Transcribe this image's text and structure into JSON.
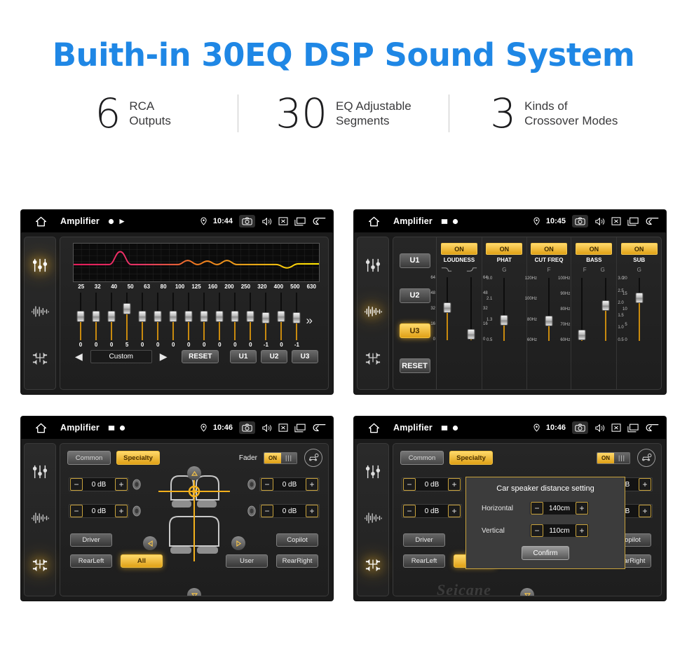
{
  "hero": {
    "title": "Buith-in 30EQ DSP Sound System",
    "title_color": "#1f87e5",
    "stats": [
      {
        "number": "6",
        "line1": "RCA",
        "line2": "Outputs"
      },
      {
        "number": "30",
        "line1": "EQ Adjustable",
        "line2": "Segments"
      },
      {
        "number": "3",
        "line1": "Kinds of",
        "line2": "Crossover Modes"
      }
    ]
  },
  "theme": {
    "accent": "#e0a117",
    "accent_light": "#ffd96b",
    "screen_bg": "#1b1b1b",
    "statusbar_bg": "#000000"
  },
  "panel_eq": {
    "statusbar": {
      "title": "Amplifier",
      "time": "10:44",
      "home_icon": "home-icon",
      "mini_icons": [
        "dot-icon",
        "play-icon"
      ],
      "location_icon": "location-pin-icon",
      "icons": [
        "camera-icon",
        "volume-icon",
        "close-box-icon",
        "recents-icon",
        "back-icon"
      ]
    },
    "rail_icons": [
      "eq-sliders-icon",
      "waveform-icon",
      "speakers-icon"
    ],
    "rail_active_index": 0,
    "frequencies": [
      "25",
      "32",
      "40",
      "50",
      "63",
      "80",
      "100",
      "125",
      "160",
      "200",
      "250",
      "320",
      "400",
      "500",
      "630"
    ],
    "values": [
      0,
      0,
      0,
      5,
      0,
      0,
      0,
      0,
      0,
      0,
      0,
      0,
      -1,
      0,
      -1
    ],
    "expand_icon": "double-chevron-right-icon",
    "prev_icon": "triangle-left-icon",
    "next_icon": "triangle-right-icon",
    "preset_label": "Custom",
    "reset_label": "RESET",
    "user_presets": [
      "U1",
      "U2",
      "U3"
    ]
  },
  "panel_crossover": {
    "statusbar": {
      "title": "Amplifier",
      "time": "10:45",
      "home_icon": "home-icon",
      "mini_icons": [
        "image-icon",
        "dot-icon"
      ],
      "location_icon": "location-pin-icon",
      "icons": [
        "camera-icon",
        "volume-icon",
        "close-box-icon",
        "recents-icon",
        "back-icon"
      ]
    },
    "rail_icons": [
      "eq-sliders-icon",
      "waveform-icon",
      "speakers-icon"
    ],
    "rail_active_index": 1,
    "presets": [
      "U1",
      "U2",
      "U3"
    ],
    "active_preset": "U3",
    "reset_label": "RESET",
    "columns": [
      {
        "name": "LOUDNESS",
        "state": "ON",
        "sublabels": [
          "curve-down-icon",
          "curve-up-icon"
        ],
        "faders": [
          {
            "scale": [
              "64",
              "48",
              "32",
              "16",
              "0"
            ],
            "side": "left",
            "pos": 0.52
          },
          {
            "scale": [
              "64",
              "48",
              "32",
              "16",
              "0"
            ],
            "side": "right",
            "pos": 0.02
          }
        ]
      },
      {
        "name": "PHAT",
        "state": "ON",
        "sublabels": [
          "G"
        ],
        "faders": [
          {
            "scale": [
              "3.0",
              "2.1",
              "1.3",
              "0.5"
            ],
            "side": "left",
            "pos": 0.3
          }
        ]
      },
      {
        "name": "CUT FREQ",
        "state": "ON",
        "sublabels": [
          "F"
        ],
        "faders": [
          {
            "scale": [
              "120Hz",
              "100Hz",
              "80Hz",
              "60Hz"
            ],
            "side": "left",
            "pos": 0.28
          }
        ]
      },
      {
        "name": "BASS",
        "state": "ON",
        "sublabels": [
          "F",
          "G"
        ],
        "faders": [
          {
            "scale": [
              "100Hz",
              "90Hz",
              "80Hz",
              "70Hz",
              "60Hz"
            ],
            "side": "left",
            "pos": 0.02
          },
          {
            "scale": [
              "3.0",
              "2.5",
              "2.0",
              "1.5",
              "1.0",
              "0.5"
            ],
            "side": "right",
            "pos": 0.58
          }
        ]
      },
      {
        "name": "SUB",
        "state": "ON",
        "sublabels": [
          "G"
        ],
        "faders": [
          {
            "scale": [
              "20",
              "15",
              "10",
              "5",
              "0"
            ],
            "side": "left",
            "pos": 0.72
          }
        ]
      }
    ]
  },
  "panel_balance": {
    "statusbar": {
      "title": "Amplifier",
      "time": "10:46",
      "home_icon": "home-icon",
      "mini_icons": [
        "image-icon",
        "dot-icon"
      ],
      "location_icon": "location-pin-icon",
      "icons": [
        "camera-icon",
        "volume-icon",
        "close-box-icon",
        "recents-icon",
        "back-icon"
      ]
    },
    "rail_icons": [
      "eq-sliders-icon",
      "waveform-icon",
      "speakers-icon"
    ],
    "rail_active_index": 2,
    "tabs": [
      {
        "label": "Common",
        "active": false
      },
      {
        "label": "Specialty",
        "active": true
      }
    ],
    "fader_label": "Fader",
    "fader_state": "ON",
    "car_settings_icon": "car-settings-icon",
    "speaker_levels": [
      {
        "position": "front-left",
        "value": "0 dB"
      },
      {
        "position": "front-right",
        "value": "0 dB"
      },
      {
        "position": "rear-left",
        "value": "0 dB"
      },
      {
        "position": "rear-right",
        "value": "0 dB"
      }
    ],
    "minus_label": "−",
    "plus_label": "+",
    "zones": [
      {
        "label": "Driver",
        "active": false
      },
      {
        "label": "Copilot",
        "active": false
      },
      {
        "label": "RearLeft",
        "active": false
      },
      {
        "label": "All",
        "active": true
      },
      {
        "label": "User",
        "active": false
      },
      {
        "label": "RearRight",
        "active": false
      }
    ],
    "nav_icons": [
      "triangle-up-icon",
      "triangle-down-icon",
      "triangle-left-icon",
      "triangle-right-icon"
    ],
    "watermark": "Seicane"
  },
  "panel_dialog": {
    "statusbar": {
      "title": "Amplifier",
      "time": "10:46",
      "home_icon": "home-icon",
      "mini_icons": [
        "image-icon",
        "dot-icon"
      ],
      "location_icon": "location-pin-icon",
      "icons": [
        "camera-icon",
        "volume-icon",
        "close-box-icon",
        "recents-icon",
        "back-icon"
      ]
    },
    "dialog": {
      "title": "Car speaker distance setting",
      "rows": [
        {
          "label": "Horizontal",
          "value": "140cm"
        },
        {
          "label": "Vertical",
          "value": "110cm"
        }
      ],
      "minus_label": "−",
      "plus_label": "+",
      "confirm_label": "Confirm"
    }
  }
}
